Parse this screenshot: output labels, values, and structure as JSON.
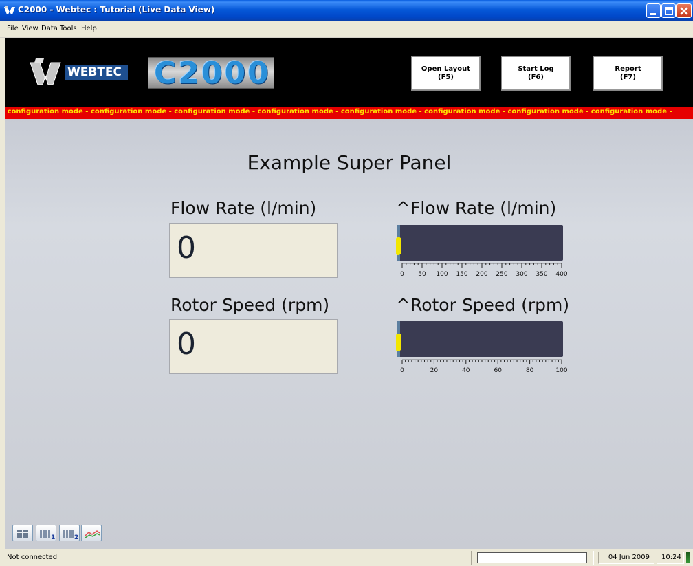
{
  "window": {
    "title": "C2000 - Webtec : Tutorial (Live Data View)"
  },
  "menu": [
    {
      "label": "File"
    },
    {
      "label": "View"
    },
    {
      "label": "Data"
    },
    {
      "label": "Tools"
    },
    {
      "label": "Help"
    }
  ],
  "header": {
    "logo_text": "WEBTEC",
    "product_text": "C2000",
    "buttons": [
      {
        "line1": "Open Layout",
        "line2": "(F5)"
      },
      {
        "line1": "Start Log",
        "line2": "(F6)"
      },
      {
        "line1": "Report",
        "line2": "(F7)"
      }
    ]
  },
  "marquee": {
    "text": "- configuration mode - configuration mode - configuration mode - configuration mode - configuration mode - configuration mode - configuration mode - configuration mode -",
    "color": "#ffe100",
    "background": "#e60000"
  },
  "panel": {
    "title": "Example Super Panel",
    "flow": {
      "label": "Flow Rate (l/min)",
      "value": "0",
      "gauge_label": "^Flow Rate (l/min)",
      "gauge_ticks": [
        "0",
        "50",
        "100",
        "150",
        "200",
        "250",
        "300",
        "350",
        "400"
      ],
      "gauge_value": 0,
      "gauge_max": 400
    },
    "rotor": {
      "label": "Rotor Speed (rpm)",
      "value": "0",
      "gauge_label": "^Rotor Speed (rpm)",
      "gauge_ticks": [
        "0",
        "20",
        "40",
        "60",
        "80",
        "100"
      ],
      "gauge_value": 0,
      "gauge_max": 100
    }
  },
  "view_buttons": [
    {
      "icon": "two-column-view-icon"
    },
    {
      "icon": "column-view-1-icon"
    },
    {
      "icon": "column-view-2-icon"
    },
    {
      "icon": "graph-view-icon"
    }
  ],
  "status": {
    "text": "Not connected",
    "date": "04 Jun 2009",
    "time": "10:24"
  }
}
